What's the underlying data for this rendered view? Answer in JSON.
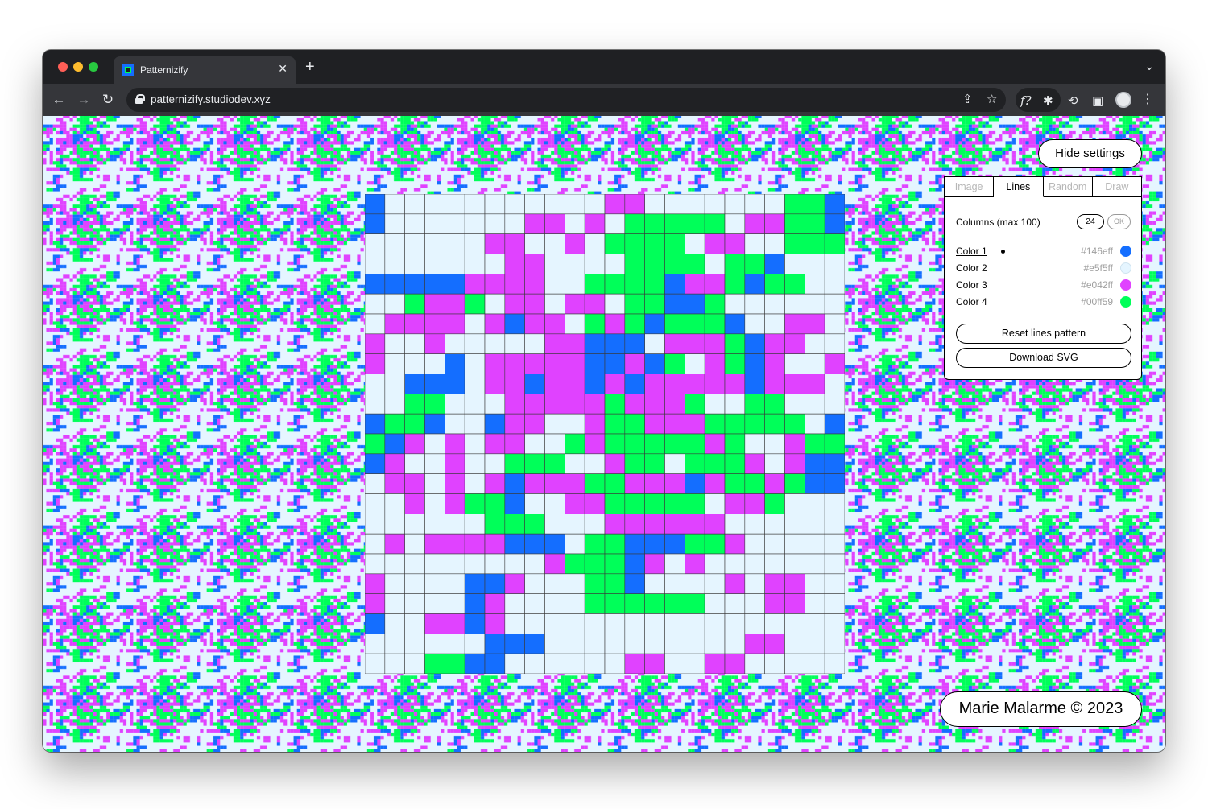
{
  "browser": {
    "tab_title": "Patternizify",
    "tab_close": "✕",
    "new_tab": "+",
    "url": "patternizify.studiodev.xyz"
  },
  "app": {
    "hide_settings_label": "Hide settings",
    "tabs": [
      {
        "label": "Image",
        "active": false
      },
      {
        "label": "Lines",
        "active": true
      },
      {
        "label": "Random",
        "active": false
      },
      {
        "label": "Draw",
        "active": false
      }
    ],
    "columns_label": "Columns (max 100)",
    "columns_value": "24",
    "ok_label": "OK",
    "colors": [
      {
        "name": "Color 1",
        "hex": "#146eff",
        "selected": true
      },
      {
        "name": "Color 2",
        "hex": "#e5f5ff",
        "selected": false
      },
      {
        "name": "Color 3",
        "hex": "#e042ff",
        "selected": false
      },
      {
        "name": "Color 4",
        "hex": "#00ff59",
        "selected": false
      }
    ],
    "reset_label": "Reset lines pattern",
    "download_label": "Download SVG",
    "credit": "Marie Malarme © 2023"
  },
  "pattern": {
    "columns": 24,
    "palette": [
      "#146eff",
      "#e5f5ff",
      "#e042ff",
      "#00ff59"
    ],
    "rows": [
      "011111111111BB11111113300",
      "01111111BB1B1333331BB3300",
      "111111BB11B133331BB113330",
      "1111111BB11113333133011111",
      "00000BBBB1133330BB3033111",
      "113BB31BB1BB133003111111",
      "1BBBB1B0BB13B30333011BB1",
      "B11B11111BB0001BBB30BB11",
      "B11101BBBBB00B031B30B11B",
      "110001BB0BB0B0BBBBB0BBB1",
      "1133111BBBBB3BBB31133111",
      "0330110BB11B33BBB3333310",
      "30B1B1BB113B33333B311B33",
      "0B11B1133311B331333B1B00",
      "1BB1B1B0BBB33BBB0B33B300",
      "11B1B33011BB333331BB3111",
      "111111333111BBBBBB111111",
      "1B1BBBB00013300033B11111",
      "111111111B3330B1B1111111",
      "B111100B1113301111B1BB11",
      "B11110B1111333333111BB11",
      "011BB0B11111111111111111",
      "1111110001111111111BB111",
      "1113300111111BB11BB11111"
    ]
  }
}
